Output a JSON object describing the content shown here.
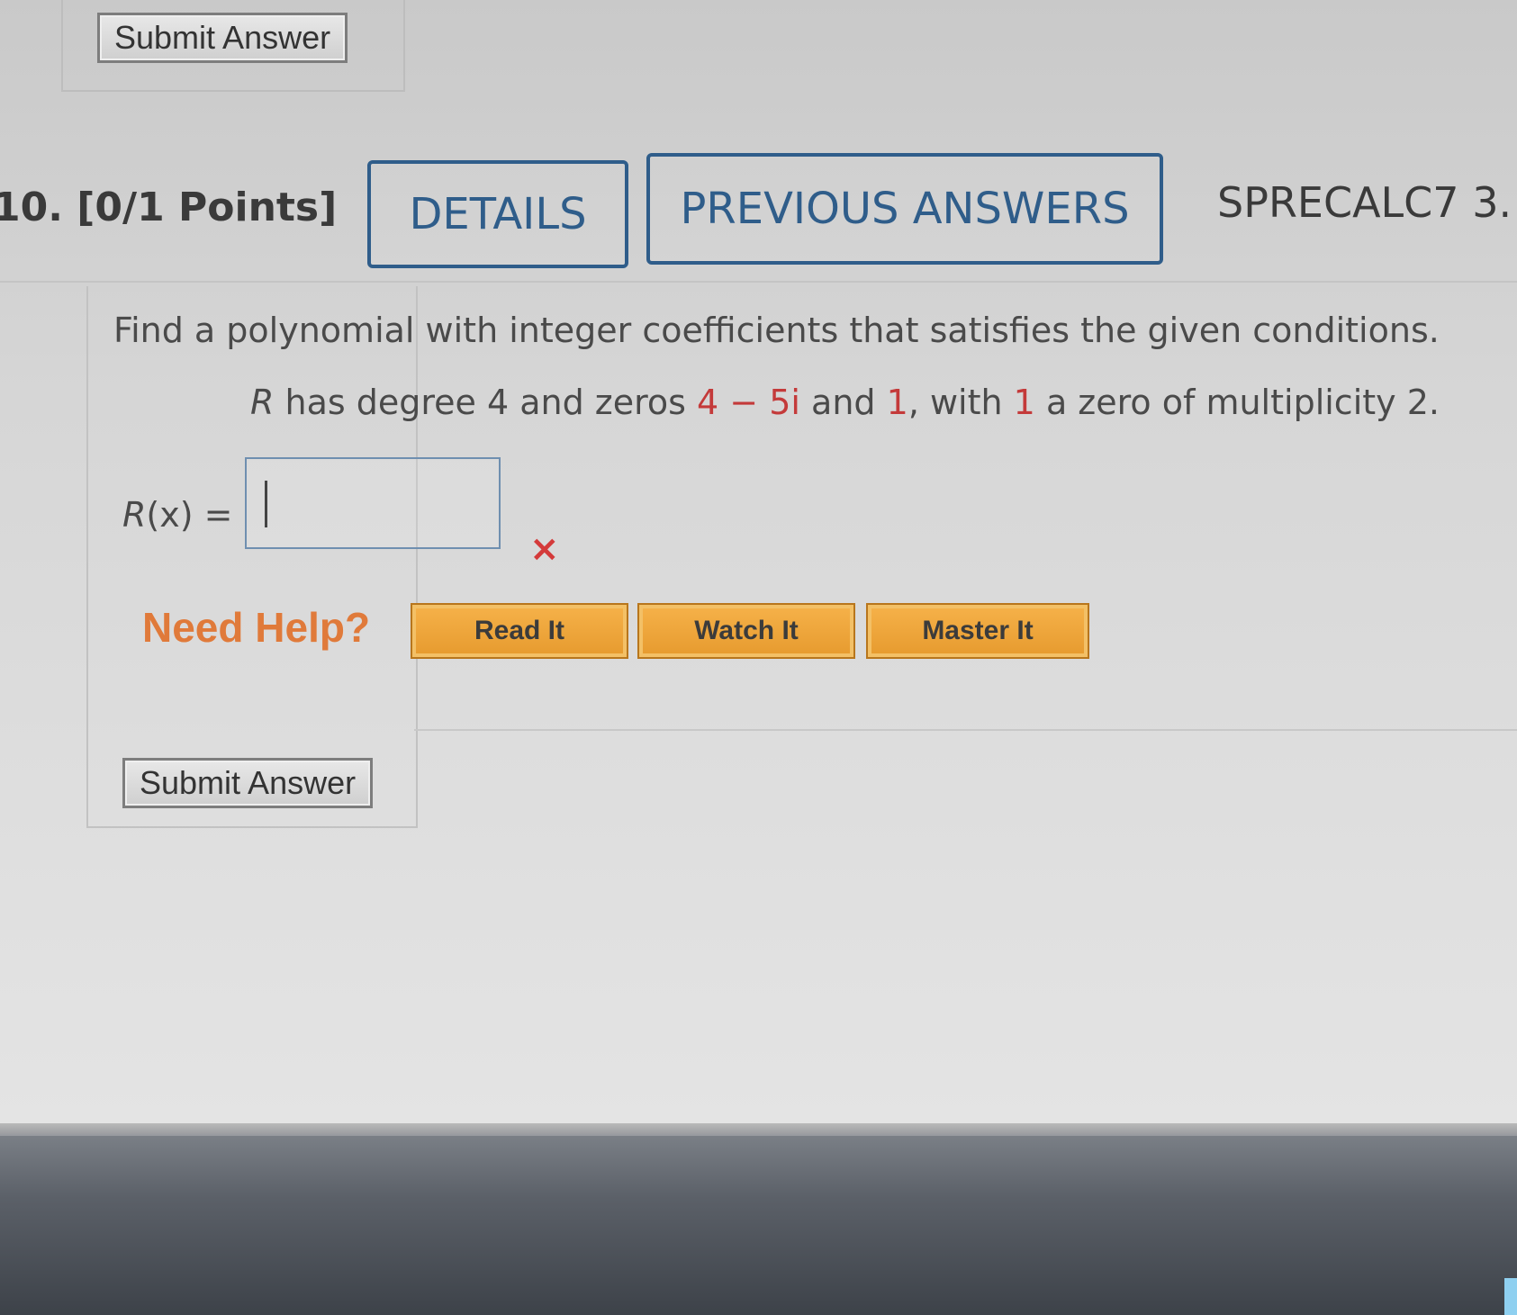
{
  "top": {
    "submit_label": "Submit Answer"
  },
  "question": {
    "number": "10.",
    "points": "[0/1 Points]",
    "details_label": "DETAILS",
    "previous_answers_label": "PREVIOUS ANSWERS",
    "course_code": "SPRECALC7 3."
  },
  "body": {
    "prompt": "Find a polynomial with integer coefficients that satisfies the given conditions.",
    "condition": {
      "var": "R",
      "text1": " has degree 4 and zeros ",
      "zero1": "4 − 5i",
      "text2": " and ",
      "zero2": "1",
      "text3": ", with ",
      "zero3": "1",
      "text4": " a zero of multiplicity 2."
    },
    "answer_label_var": "R",
    "answer_label_rest": "(x) =",
    "answer_value": "",
    "status_icon": "×"
  },
  "help": {
    "title": "Need Help?",
    "read_label": "Read It",
    "watch_label": "Watch It",
    "master_label": "Master It"
  },
  "bottom": {
    "submit_label": "Submit Answer"
  },
  "colors": {
    "accent_blue": "#2f5d8a",
    "error_red": "#d43a3a",
    "help_orange": "#e07a3a",
    "help_button": "#f6b24a"
  }
}
